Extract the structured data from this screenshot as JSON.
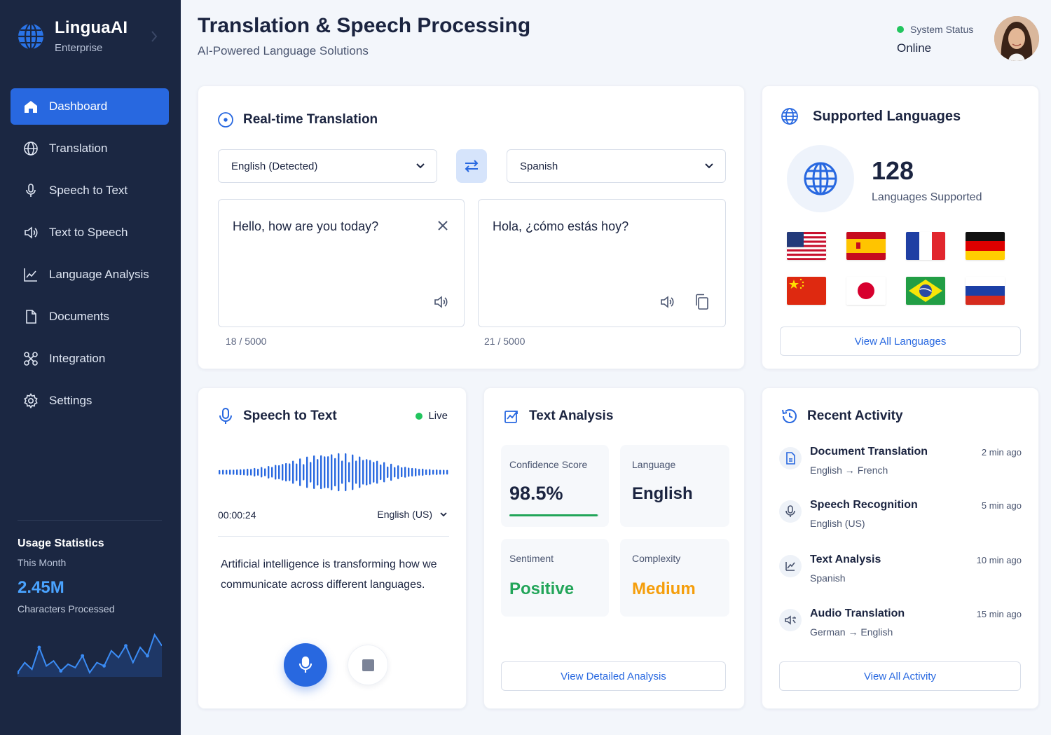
{
  "brand": {
    "name": "LinguaAI",
    "edition": "Enterprise"
  },
  "nav": [
    {
      "label": "Dashboard",
      "icon": "home-icon",
      "active": true
    },
    {
      "label": "Translation",
      "icon": "globe-icon"
    },
    {
      "label": "Speech to Text",
      "icon": "microphone-icon"
    },
    {
      "label": "Text to Speech",
      "icon": "speaker-icon"
    },
    {
      "label": "Language Analysis",
      "icon": "chart-icon"
    },
    {
      "label": "Documents",
      "icon": "document-icon"
    },
    {
      "label": "Integration",
      "icon": "integration-icon"
    },
    {
      "label": "Settings",
      "icon": "gear-icon"
    }
  ],
  "usage": {
    "title": "Usage Statistics",
    "period": "This Month",
    "value": "2.45M",
    "label": "Characters Processed",
    "trend": [
      10,
      22,
      14,
      40,
      18,
      24,
      12,
      20,
      16,
      30,
      10,
      22,
      18,
      36,
      28,
      42,
      22,
      40,
      30,
      55,
      42
    ]
  },
  "header": {
    "title": "Translation & Speech Processing",
    "subtitle": "AI-Powered Language Solutions",
    "status_label": "System Status",
    "status_value": "Online"
  },
  "translation": {
    "title": "Real-time Translation",
    "source_language": "English (Detected)",
    "target_language": "Spanish",
    "source_text": "Hello, how are you today?",
    "target_text": "Hola, ¿cómo estás hoy?",
    "source_count": "18 / 5000",
    "target_count": "21 / 5000"
  },
  "languages": {
    "title": "Supported Languages",
    "count": "128",
    "count_label": "Languages Supported",
    "flags": [
      "us-flag",
      "spain-flag",
      "france-flag",
      "germany-flag",
      "china-flag",
      "japan-flag",
      "brazil-flag",
      "russia-flag"
    ],
    "button": "View All Languages"
  },
  "speech": {
    "title": "Speech to Text",
    "live_label": "Live",
    "timer": "00:00:24",
    "language": "English (US)",
    "transcript_line1": "Artificial intelligence is transforming how we",
    "transcript_line2": "communicate across different languages."
  },
  "analysis": {
    "title": "Text Analysis",
    "metrics": [
      {
        "label": "Confidence Score",
        "value": "98.5%",
        "color": "#1b2440",
        "progress": 0.985
      },
      {
        "label": "Language",
        "value": "English",
        "color": "#1b2440"
      },
      {
        "label": "Sentiment",
        "value": "Positive",
        "color": "#22a559"
      },
      {
        "label": "Complexity",
        "value": "Medium",
        "color": "#f59e0b"
      }
    ],
    "button": "View Detailed Analysis"
  },
  "activity": {
    "title": "Recent Activity",
    "items": [
      {
        "title": "Document Translation",
        "sub": "English → French",
        "time": "2 min ago",
        "icon": "document-icon"
      },
      {
        "title": "Speech Recognition",
        "sub": "English (US)",
        "time": "5 min ago",
        "icon": "microphone-icon"
      },
      {
        "title": "Text Analysis",
        "sub": "Spanish",
        "time": "10 min ago",
        "icon": "analysis-icon"
      },
      {
        "title": "Audio Translation",
        "sub": "German → English",
        "time": "15 min ago",
        "icon": "audio-translate-icon"
      }
    ],
    "button": "View All Activity"
  },
  "colors": {
    "accent": "#2868e0",
    "sidebar": "#1b2742",
    "success": "#22a559",
    "warning": "#f59e0b"
  }
}
